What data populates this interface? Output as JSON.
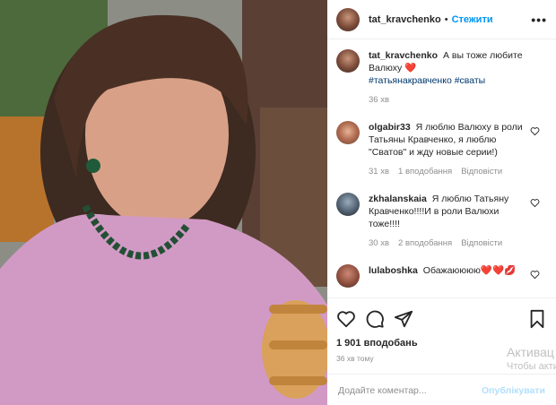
{
  "post": {
    "username": "tat_kravchenko",
    "separator": "•",
    "follow_label": "Стежити",
    "more_label": "•••"
  },
  "caption": {
    "username": "tat_kravchenko",
    "text": "А вы тоже любите Валюху ❤️",
    "tags": "#татьянакравченко #сваты",
    "time": "36 хв"
  },
  "comments": [
    {
      "username": "olgabir33",
      "text": "Я люблю Валюху в роли Татьяны Кравченко, я люблю \"Сватов\" и жду новые серии!)",
      "time": "31 хв",
      "likes": "1 вподобання",
      "reply": "Відповісти"
    },
    {
      "username": "zkhalanskaia",
      "text": "Я люблю Татьяну Кравченко!!!!И в роли Валюхи тоже!!!!",
      "time": "30 хв",
      "likes": "2 вподобання",
      "reply": "Відповісти"
    },
    {
      "username": "lulaboshka",
      "text": "Обажаюююю❤️❤️💋"
    }
  ],
  "actions": {
    "likes_count": "1 901 вподобань",
    "time_ago": "36 хв тому"
  },
  "add_comment": {
    "placeholder": "Додайте коментар...",
    "publish_label": "Опублікувати"
  },
  "watermark": {
    "line1": "Активац",
    "line2": "Чтобы акти"
  },
  "icons": [
    "heart-icon",
    "comment-icon",
    "share-icon",
    "bookmark-icon",
    "more-icon"
  ]
}
